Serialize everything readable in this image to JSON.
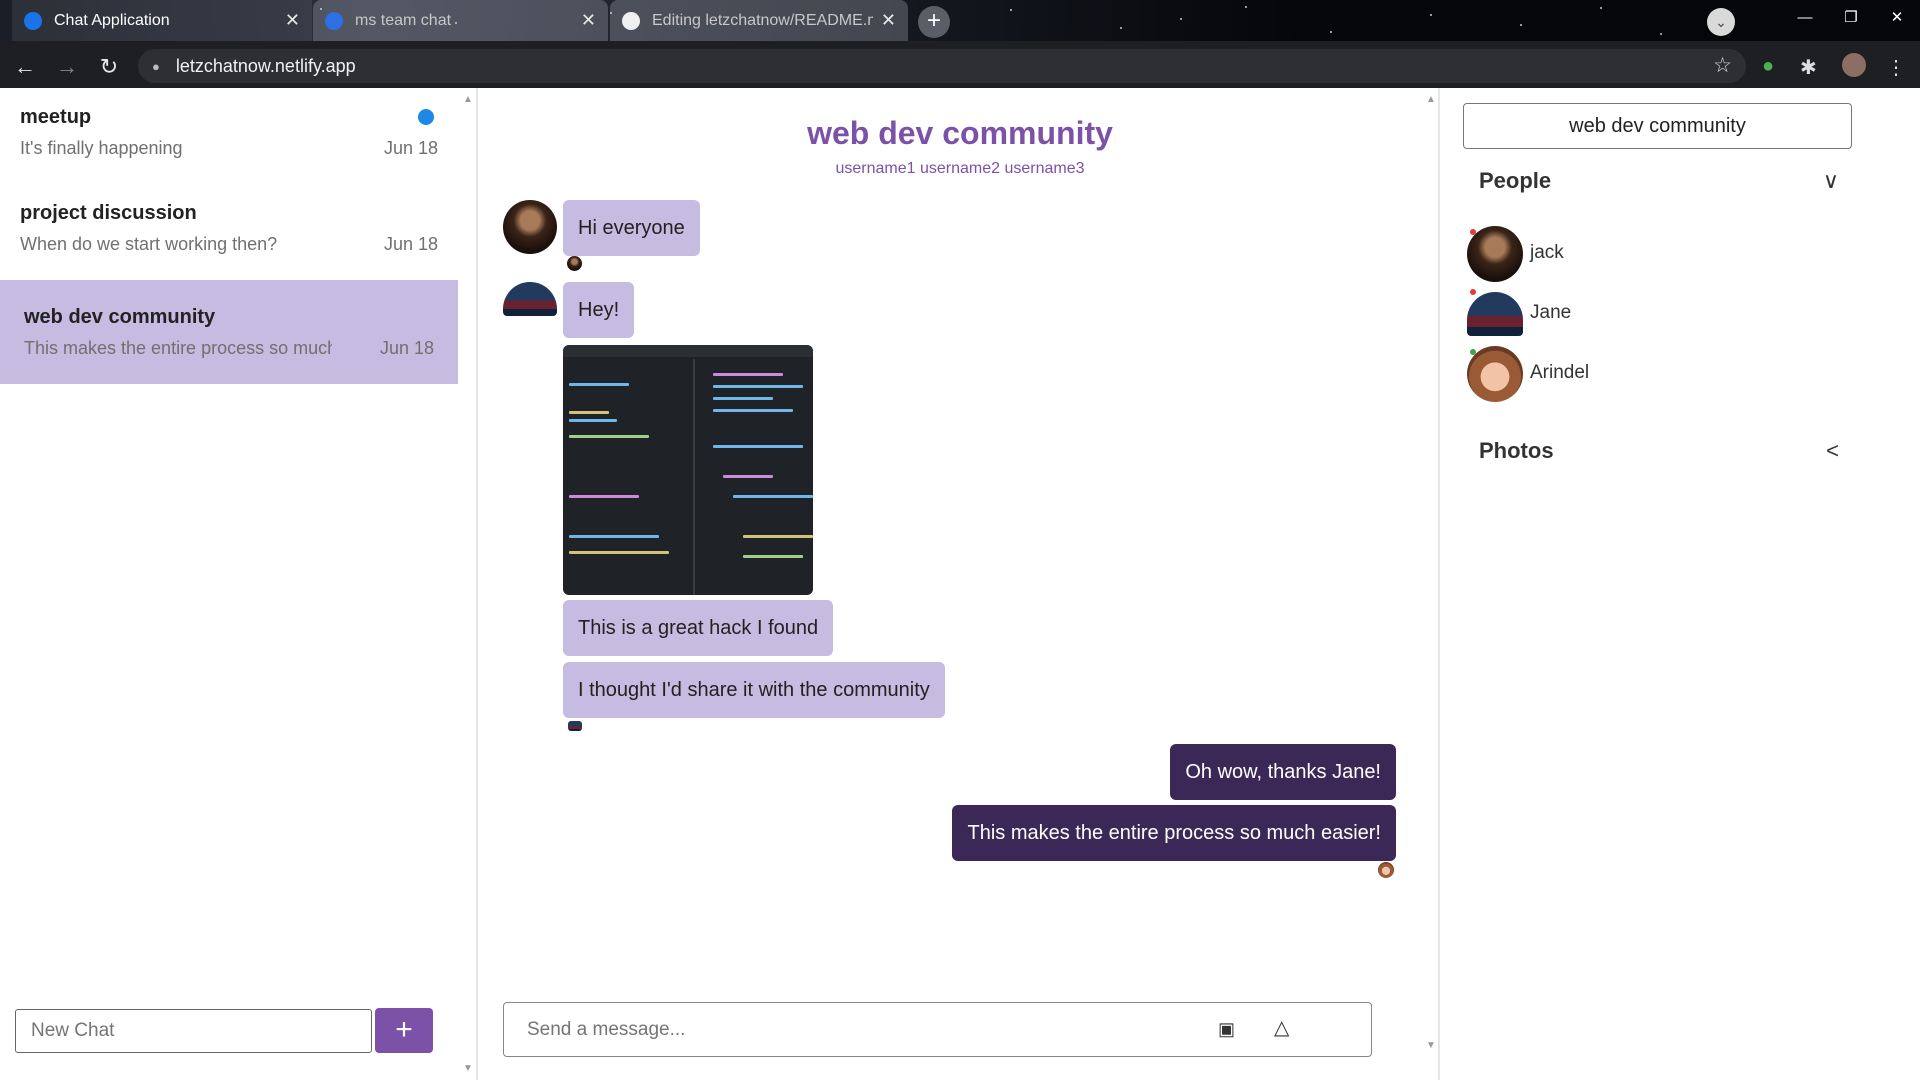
{
  "browser": {
    "tabs": [
      {
        "title": "Chat Application",
        "active": true
      },
      {
        "title": "ms team chat",
        "active": false
      },
      {
        "title": "Editing letzchatnow/README.md",
        "active": false
      }
    ],
    "url": "letzchatnow.netlify.app"
  },
  "sidebar": {
    "chats": [
      {
        "name": "meetup",
        "preview": "It's finally happening",
        "date": "Jun 18",
        "unread": true
      },
      {
        "name": "project discussion",
        "preview": "When do we start working then?",
        "date": "Jun 18",
        "unread": false
      },
      {
        "name": "web dev community",
        "preview": "This makes the entire process so much easier!",
        "date": "Jun 18",
        "selected": true
      }
    ],
    "new_chat_placeholder": "New Chat",
    "new_chat_button": "+"
  },
  "chat": {
    "title": "web dev community",
    "members": "username1 username2 username3",
    "messages": [
      {
        "sender": "jack",
        "text": "Hi everyone",
        "direction": "incoming"
      },
      {
        "sender": "Jane",
        "text": "Hey!",
        "direction": "incoming"
      },
      {
        "sender": "Jane",
        "attachment": "code-screenshot",
        "direction": "incoming"
      },
      {
        "sender": "Jane",
        "text": "This is a great hack I found",
        "direction": "incoming"
      },
      {
        "sender": "Jane",
        "text": "I thought I'd share it with the community",
        "direction": "incoming"
      },
      {
        "sender": "me",
        "text": "Oh wow, thanks Jane!",
        "direction": "outgoing"
      },
      {
        "sender": "me",
        "text": "This makes the entire process so much easier!",
        "direction": "outgoing"
      }
    ],
    "composer_placeholder": "Send a message..."
  },
  "settings": {
    "title": "web dev community",
    "people_label": "People",
    "people": [
      {
        "name": "jack",
        "online": false
      },
      {
        "name": "Jane",
        "online": false
      },
      {
        "name": "Arindel",
        "online": true
      }
    ],
    "photos_label": "Photos"
  },
  "colors": {
    "accent": "#7c52a8",
    "incoming_bubble": "#c6bbe0",
    "outgoing_bubble": "#3b2857",
    "unread_dot": "#1e88e5",
    "offline": "#e53935",
    "online": "#43a047"
  },
  "icons": {
    "upload": "image-icon",
    "send": "send-icon",
    "people_toggle": "chevron-down-icon",
    "photos_toggle": "chevron-left-icon"
  }
}
